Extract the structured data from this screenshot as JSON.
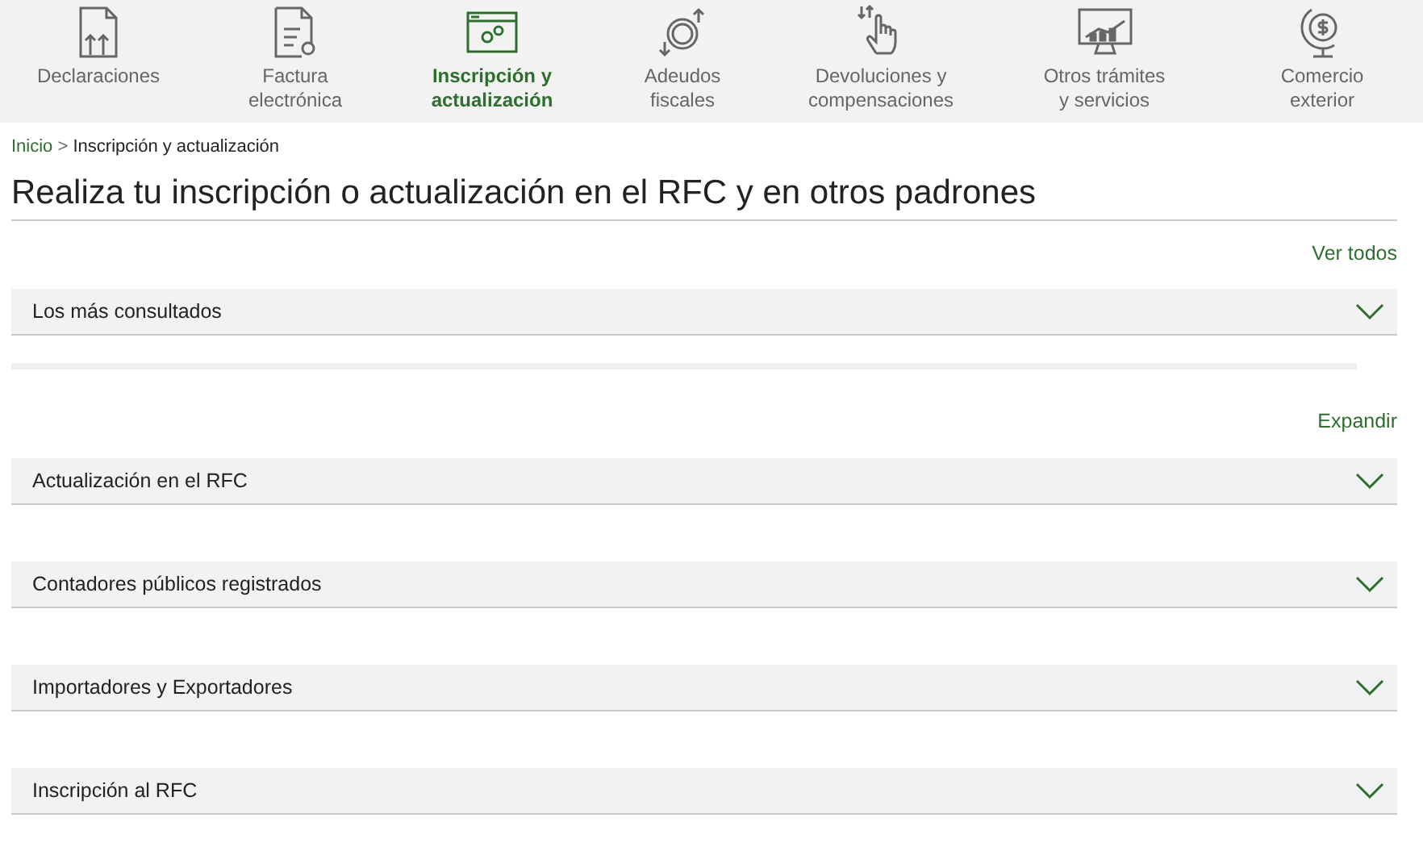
{
  "nav": [
    {
      "label": "Declaraciones",
      "selected": false
    },
    {
      "label": "Factura\nelectrónica",
      "selected": false
    },
    {
      "label": "Inscripción y\nactualización",
      "selected": true
    },
    {
      "label": "Adeudos\nfiscales",
      "selected": false
    },
    {
      "label": "Devoluciones y\ncompensaciones",
      "selected": false
    },
    {
      "label": "Otros trámites\ny servicios",
      "selected": false
    },
    {
      "label": "Comercio\nexterior",
      "selected": false
    }
  ],
  "breadcrumb": {
    "home": "Inicio",
    "separator": ">",
    "current": "Inscripción y actualización"
  },
  "title": "Realiza tu inscripción o actualización en el RFC y en otros padrones",
  "featured": {
    "link": "Ver todos",
    "sections": [
      {
        "label": "Los más consultados",
        "expanded": false
      }
    ]
  },
  "catalog": {
    "link": "Expandir",
    "sections": [
      {
        "label": "Actualización en el RFC",
        "expanded": false
      },
      {
        "label": "Contadores públicos registrados",
        "expanded": false
      },
      {
        "label": "Importadores y Exportadores",
        "expanded": false
      },
      {
        "label": "Inscripción al RFC",
        "expanded": false
      }
    ]
  }
}
